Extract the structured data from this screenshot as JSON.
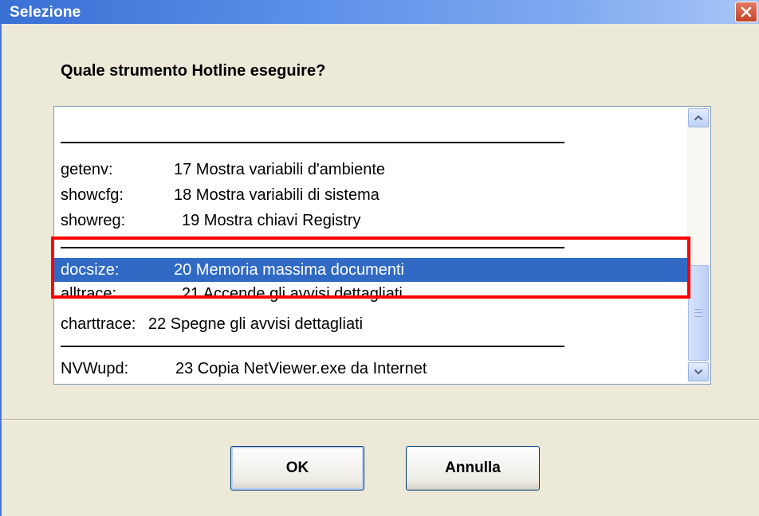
{
  "window": {
    "title": "Selezione",
    "close_label": "×"
  },
  "prompt": "Quale strumento Hotline eseguire?",
  "list": {
    "items": [
      {
        "code": "getenv:",
        "desc": "17 Mostra variabili d'ambiente"
      },
      {
        "code": "showcfg:",
        "desc": "18 Mostra variabili di sistema"
      },
      {
        "code": "showreg:",
        "desc": "19 Mostra chiavi Registry"
      },
      {
        "code": "docsize:",
        "desc": "20 Memoria massima documenti"
      },
      {
        "code": "alltrace:",
        "desc": "21 Accende gli avvisi dettagliati"
      },
      {
        "code": "charttrace:",
        "desc": "22 Spegne gli avvisi dettagliati"
      },
      {
        "code": "NVWupd:",
        "desc": "23 Copia NetViewer.exe da Internet"
      }
    ],
    "selected_index": 3
  },
  "buttons": {
    "ok": "OK",
    "cancel": "Annulla"
  },
  "colors": {
    "selection": "#316ac5",
    "highlight_box": "#ff0000",
    "titlebar": "#3a6fd4"
  }
}
